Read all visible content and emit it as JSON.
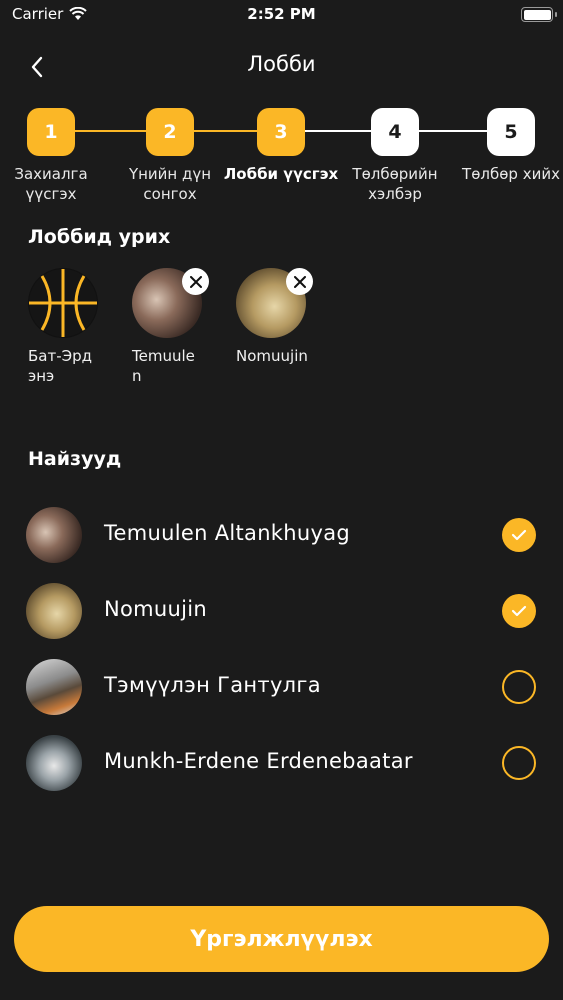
{
  "status_bar": {
    "carrier": "Carrier",
    "time": "2:52 PM"
  },
  "header": {
    "title": "Лобби"
  },
  "steps": [
    {
      "number": "1",
      "label": "Захиалга үүсгэх",
      "state": "done"
    },
    {
      "number": "2",
      "label": "Үнийн дүн сонгох",
      "state": "done"
    },
    {
      "number": "3",
      "label": "Лобби үүсгэх",
      "state": "active"
    },
    {
      "number": "4",
      "label": "Төлбөрийн хэлбэр",
      "state": "todo"
    },
    {
      "number": "5",
      "label": "Төлбөр хийх",
      "state": "todo"
    }
  ],
  "lobby": {
    "title": "Лоббид урих",
    "members": [
      {
        "name": "Бат-Эрдэнэ",
        "removable": false
      },
      {
        "name": "Temuulen",
        "removable": true
      },
      {
        "name": "Nomuujin",
        "removable": true
      }
    ]
  },
  "friends": {
    "title": "Найзууд",
    "items": [
      {
        "name": "Temuulen Altankhuyag",
        "selected": true
      },
      {
        "name": "Nomuujin",
        "selected": true
      },
      {
        "name": "Тэмүүлэн Гантулга",
        "selected": false
      },
      {
        "name": "Munkh-Erdene Erdenebaatar",
        "selected": false
      }
    ]
  },
  "continue_button": {
    "label": "Үргэлжлүүлэх"
  },
  "colors": {
    "accent": "#fbb726",
    "background": "#1b1b1b"
  }
}
